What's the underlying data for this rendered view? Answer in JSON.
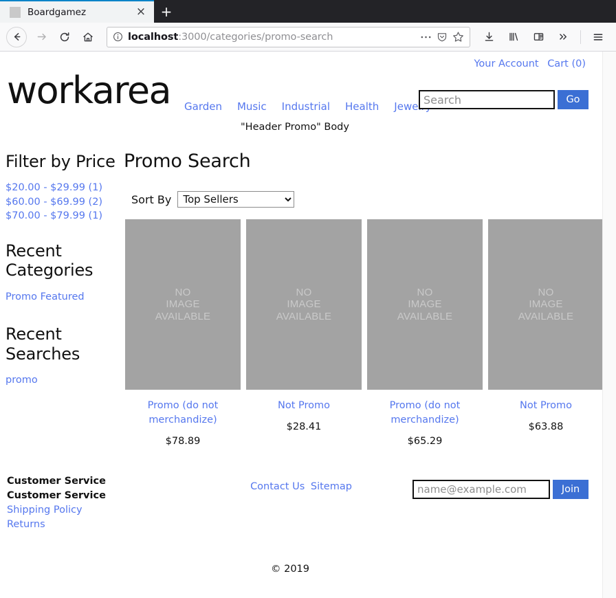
{
  "browser": {
    "tab": {
      "title": "Boardgamez",
      "close_label": "×",
      "favicon": "page-icon"
    },
    "newtab_label": "+",
    "nav": {
      "back": "back-arrow-icon",
      "forward": "forward-arrow-icon",
      "reload": "reload-icon",
      "home": "home-icon"
    },
    "url": {
      "host": "localhost",
      "path": ":3000/categories/promo-search",
      "info_icon": "info-circle-icon",
      "page_actions_icon": "ellipsis-icon",
      "pocket_icon": "pocket-shield-icon",
      "bookmark_icon": "star-icon"
    },
    "toolbar": {
      "downloads": "download-icon",
      "library": "library-icon",
      "sidebar": "sidebar-panel-icon",
      "overflow": "double-chevron-icon",
      "menu": "hamburger-menu-icon"
    }
  },
  "site": {
    "account_links": [
      {
        "label": "Your Account"
      },
      {
        "label": "Cart (0)"
      }
    ],
    "logo": "workarea",
    "search": {
      "value": "",
      "placeholder": "Search",
      "button_label": "Go"
    },
    "nav": [
      {
        "label": "Garden"
      },
      {
        "label": "Music"
      },
      {
        "label": "Industrial"
      },
      {
        "label": "Health"
      },
      {
        "label": "Jewelry"
      }
    ],
    "promo_body": "\"Header Promo\" Body"
  },
  "sidebar": {
    "filter_heading": "Filter by Price",
    "price_filters": [
      {
        "label": "$20.00 - $29.99 (1)"
      },
      {
        "label": "$60.00 - $69.99 (2)"
      },
      {
        "label": "$70.00 - $79.99 (1)"
      }
    ],
    "recent_categories_heading": "Recent Categories",
    "recent_categories": [
      {
        "label": "Promo Featured"
      }
    ],
    "recent_searches_heading": "Recent Searches",
    "recent_searches": [
      {
        "label": "promo"
      }
    ]
  },
  "main": {
    "title": "Promo Search",
    "sort": {
      "label": "Sort By",
      "value": "Top Sellers",
      "options": [
        "Top Sellers"
      ]
    },
    "placeholder_image_text": "NO\nIMAGE\nAVAILABLE",
    "products": [
      {
        "name": "Promo (do not merchandize)",
        "price": "$78.89",
        "image": "no-image-available"
      },
      {
        "name": "Not Promo",
        "price": "$28.41",
        "image": "no-image-available"
      },
      {
        "name": "Promo (do not merchandize)",
        "price": "$65.29",
        "image": "no-image-available"
      },
      {
        "name": "Not Promo",
        "price": "$63.88",
        "image": "no-image-available"
      }
    ]
  },
  "footer": {
    "left": {
      "heading": "Customer Service",
      "subheading": "Customer Service",
      "links": [
        {
          "label": "Shipping Policy"
        },
        {
          "label": "Returns"
        }
      ]
    },
    "middle_links": [
      {
        "label": "Contact Us"
      },
      {
        "label": "Sitemap"
      }
    ],
    "signup": {
      "value": "",
      "placeholder": "name@example.com",
      "button_label": "Join"
    },
    "copyright": "© 2019"
  },
  "colors": {
    "link": "#5577ee",
    "button": "#3b6fd4",
    "placeholder_bg": "#a3a3a3",
    "tab_accent": "#0a84c8"
  }
}
